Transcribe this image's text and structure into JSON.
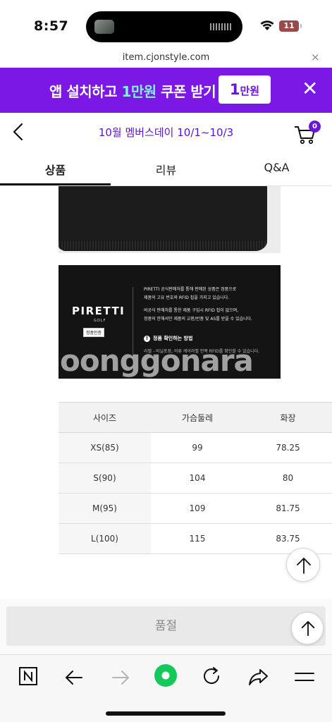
{
  "status_bar": {
    "time": "8:57",
    "battery": "11",
    "battery_color": "#9b4a4a"
  },
  "url_bar": {
    "url": "item.cjonstyle.com",
    "close": "×"
  },
  "promo_banner": {
    "text_before": "앱 설치하고 ",
    "text_highlight": "1만원",
    "text_after": " 쿠폰 받기",
    "badge_big": "1",
    "badge_small": "만원",
    "close": "✕",
    "background": "#7b18e6",
    "highlight_color": "#7ff3d8"
  },
  "header": {
    "title": "10월 멤버스데이 10/1~10/3",
    "cart_count": "0",
    "accent": "#6a16d6"
  },
  "tabs": [
    {
      "label": "상품",
      "active": true
    },
    {
      "label": "리뷰",
      "active": false
    },
    {
      "label": "Q&A",
      "active": false
    }
  ],
  "authenticity_image": {
    "brand": "PIRETTI",
    "brand_sub": "GOLF",
    "stamp": "정품인증",
    "para1_line1": "PIRETTI 공식판매처를 통해 판매된 상품은 정품으로",
    "para1_line2": "제품의 고유 번호와 RFID 칩을 가지고 있습니다.",
    "para2_line1": "비공식 판매처를 통한 제품 구입시 RFID 칩이 없으며,",
    "para2_line2": "정품의 한해서만 제품의 교환/반품 및 AS를 받을 수 있습니다.",
    "warn_title": "정품 확인하는 방법",
    "warn_text": "라벨 - 비닐포장, 의류 케어라벨 안쪽 RFID를 확인할 수 있습니다.",
    "watermark": "oonggonara"
  },
  "size_table": {
    "headers": [
      "사이즈",
      "가슴둘레",
      "화장"
    ],
    "rows": [
      [
        "XS(85)",
        "99",
        "78.25"
      ],
      [
        "S(90)",
        "104",
        "80"
      ],
      [
        "M(95)",
        "109",
        "81.75"
      ],
      [
        "L(100)",
        "115",
        "83.75"
      ]
    ]
  },
  "purchase": {
    "soldout_label": "품절"
  },
  "browser_toolbar": {
    "icons": [
      "naver-icon",
      "back-arrow-icon",
      "forward-arrow-icon",
      "green-dot-icon",
      "refresh-icon",
      "share-icon",
      "menu-icon"
    ],
    "green": "#14c85a"
  }
}
